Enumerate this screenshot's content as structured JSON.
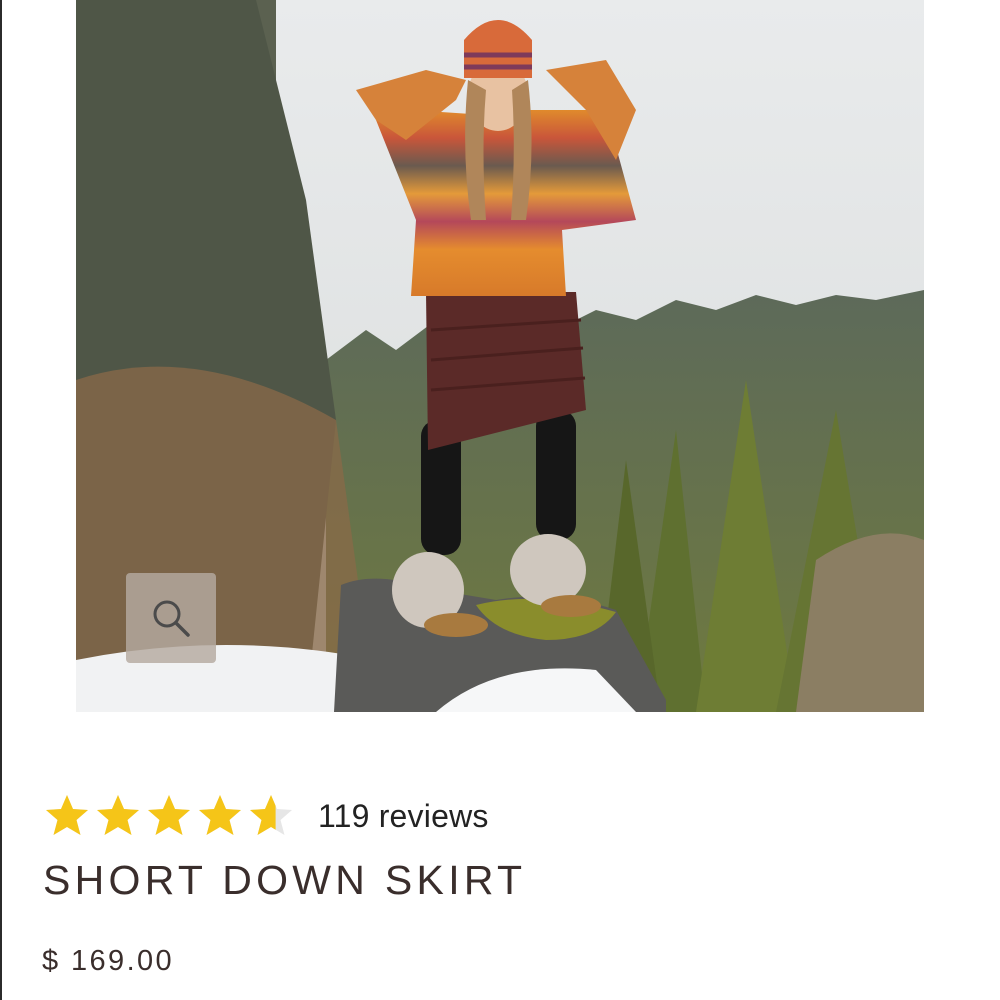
{
  "product": {
    "title": "SHORT DOWN SKIRT",
    "price": "$ 169.00",
    "image_subject": "woman-in-striped-sweater-and-down-skirt-on-snowy-rock"
  },
  "rating": {
    "value": 4.6,
    "max": 5,
    "reviews_text": "119 reviews",
    "star_color": "#f5c518",
    "empty_color": "#e6e6e6"
  },
  "zoom": {
    "icon": "magnifier-icon"
  },
  "colors": {
    "title_text": "#3a2e2c",
    "zoom_bg": "#b4aaa0"
  }
}
